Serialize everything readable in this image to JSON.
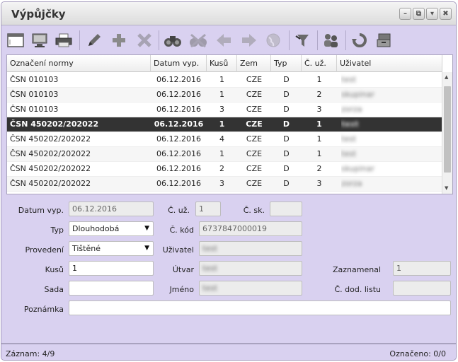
{
  "window": {
    "title": "Výpůjčky",
    "buttons": {
      "minimize": "–",
      "restore": "⧉",
      "menu": "▾",
      "close": "✖"
    }
  },
  "toolbar": {
    "icons": [
      "window-icon",
      "monitor-icon",
      "print-icon",
      "edit-icon",
      "add-icon",
      "delete-icon",
      "find-icon",
      "find-clear-icon",
      "back-arrow-icon",
      "forward-arrow-icon",
      "globe-icon",
      "filter-icon",
      "users-icon",
      "recycle-icon",
      "archive-icon"
    ]
  },
  "grid": {
    "columns": [
      "Označení normy",
      "Datum vyp.",
      "Kusů",
      "Zem",
      "Typ",
      "Č. už.",
      "Uživatel"
    ],
    "rows": [
      {
        "norma": "ČSN 010103",
        "datum": "06.12.2016",
        "kusu": "1",
        "zem": "CZE",
        "typ": "D",
        "cuz": "1",
        "uzivatel": "test"
      },
      {
        "norma": "ČSN 010103",
        "datum": "06.12.2016",
        "kusu": "1",
        "zem": "CZE",
        "typ": "D",
        "cuz": "2",
        "uzivatel": "skupinar"
      },
      {
        "norma": "ČSN 010103",
        "datum": "06.12.2016",
        "kusu": "3",
        "zem": "CZE",
        "typ": "D",
        "cuz": "3",
        "uzivatel": "zorza"
      },
      {
        "norma": "ČSN 450202/202022",
        "datum": "06.12.2016",
        "kusu": "1",
        "zem": "CZE",
        "typ": "D",
        "cuz": "1",
        "uzivatel": "test"
      },
      {
        "norma": "ČSN 450202/202022",
        "datum": "06.12.2016",
        "kusu": "4",
        "zem": "CZE",
        "typ": "D",
        "cuz": "1",
        "uzivatel": "test"
      },
      {
        "norma": "ČSN 450202/202022",
        "datum": "06.12.2016",
        "kusu": "1",
        "zem": "CZE",
        "typ": "D",
        "cuz": "1",
        "uzivatel": "test"
      },
      {
        "norma": "ČSN 450202/202022",
        "datum": "06.12.2016",
        "kusu": "2",
        "zem": "CZE",
        "typ": "D",
        "cuz": "2",
        "uzivatel": "skupinar"
      },
      {
        "norma": "ČSN 450202/202022",
        "datum": "06.12.2016",
        "kusu": "3",
        "zem": "CZE",
        "typ": "D",
        "cuz": "3",
        "uzivatel": "zorza"
      }
    ],
    "selected_index": 3
  },
  "form": {
    "datum_label": "Datum vyp.",
    "datum_value": "06.12.2016",
    "cuz_label": "Č. už.",
    "cuz_value": "1",
    "csk_label": "Č. sk.",
    "csk_value": "",
    "typ_label": "Typ",
    "typ_value": "Dlouhodobá",
    "ckod_label": "Č. kód",
    "ckod_value": "6737847000019",
    "provedeni_label": "Provedení",
    "provedeni_value": "Tištěné",
    "uzivatel_label": "Uživatel",
    "uzivatel_value": "test",
    "kusu_label": "Kusů",
    "kusu_value": "1",
    "utvar_label": "Útvar",
    "utvar_value": "test",
    "zaznamenal_label": "Zaznamenal",
    "zaznamenal_value": "1",
    "sada_label": "Sada",
    "sada_value": "",
    "jmeno_label": "Jméno",
    "jmeno_value": "test",
    "cdod_label": "Č. dod. listu",
    "cdod_value": "",
    "poznamka_label": "Poznámka",
    "poznamka_value": ""
  },
  "status": {
    "zaznam": "Záznam:  4/9",
    "oznaceno": "Označeno: 0/0"
  }
}
